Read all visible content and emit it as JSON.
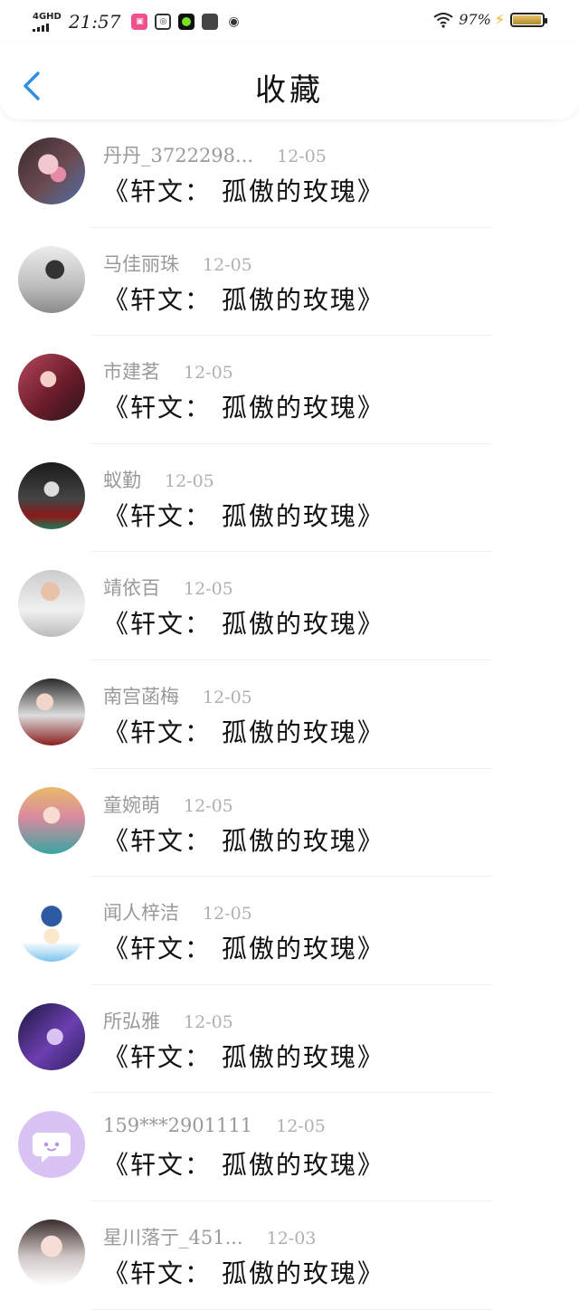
{
  "status_bar": {
    "network": "4GHD",
    "time": "21:57",
    "battery_percent": "97%",
    "battery_level": 0.97,
    "app_icons": [
      "ticket-app-icon",
      "qr-app-icon",
      "green-app-icon",
      "dark-app-icon",
      "weibo-icon"
    ]
  },
  "header": {
    "title": "收藏"
  },
  "items": [
    {
      "name": "丹丹_3722298...",
      "date": "12-05",
      "content": "《轩文： 孤傲的玫瑰》"
    },
    {
      "name": "马佳丽珠",
      "date": "12-05",
      "content": "《轩文： 孤傲的玫瑰》"
    },
    {
      "name": "市建茗",
      "date": "12-05",
      "content": "《轩文： 孤傲的玫瑰》"
    },
    {
      "name": "蚁勤",
      "date": "12-05",
      "content": "《轩文： 孤傲的玫瑰》"
    },
    {
      "name": "靖依百",
      "date": "12-05",
      "content": "《轩文： 孤傲的玫瑰》"
    },
    {
      "name": "南宫菡梅",
      "date": "12-05",
      "content": "《轩文： 孤傲的玫瑰》"
    },
    {
      "name": "童婉萌",
      "date": "12-05",
      "content": "《轩文： 孤傲的玫瑰》"
    },
    {
      "name": "闻人梓洁",
      "date": "12-05",
      "content": "《轩文： 孤傲的玫瑰》"
    },
    {
      "name": "所弘雅",
      "date": "12-05",
      "content": "《轩文： 孤傲的玫瑰》"
    },
    {
      "name": "159***2901111",
      "date": "12-05",
      "content": "《轩文： 孤傲的玫瑰》"
    },
    {
      "name": "星川落亍_451...",
      "date": "12-03",
      "content": "《轩文： 孤傲的玫瑰》"
    }
  ],
  "colors": {
    "accent": "#2b8fe6",
    "name_text": "#9a9a9a",
    "content_text": "#111111"
  }
}
